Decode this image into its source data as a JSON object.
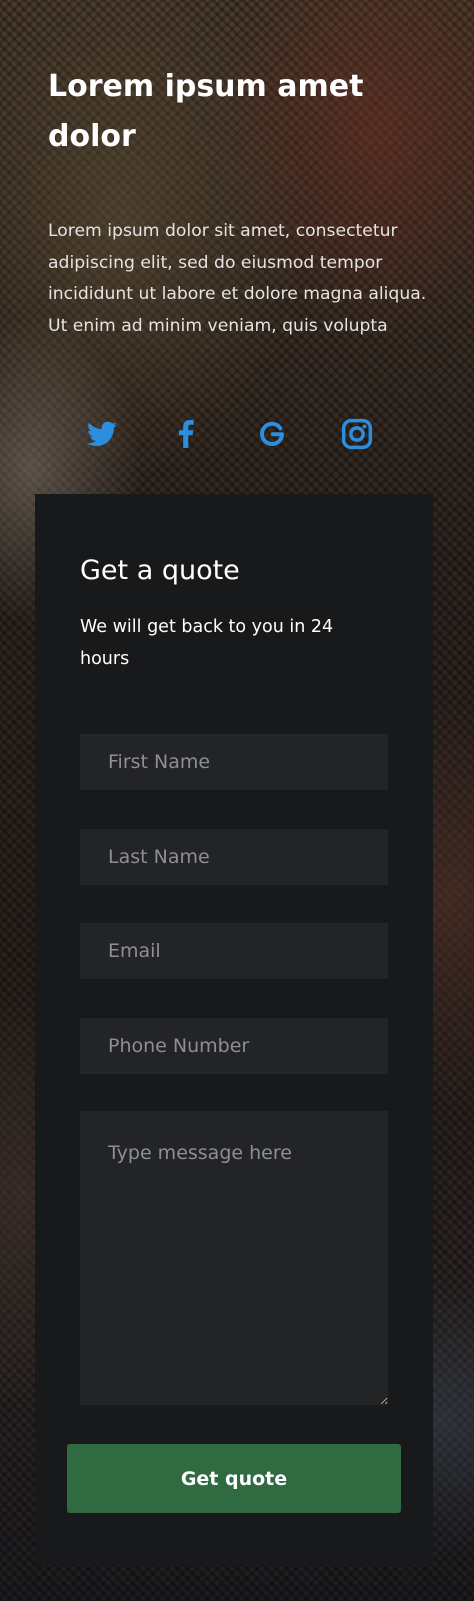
{
  "hero": {
    "title": "Lorem ipsum amet dolor",
    "body": "Lorem ipsum dolor sit amet, consectetur adipiscing elit, sed do eiusmod tempor incididunt ut labore et dolore magna aliqua. Ut enim ad minim veniam, quis volupta"
  },
  "social": {
    "accent_color": "#2b8fe0",
    "icons": [
      "twitter-icon",
      "facebook-icon",
      "google-icon",
      "instagram-icon"
    ]
  },
  "quote_form": {
    "title": "Get a quote",
    "subtitle": "We will get back to you in 24 hours",
    "first_name_placeholder": "First Name",
    "last_name_placeholder": "Last Name",
    "email_placeholder": "Email",
    "phone_placeholder": "Phone Number",
    "message_placeholder": "Type message here",
    "submit_label": "Get quote",
    "submit_color": "#2f6a40"
  }
}
